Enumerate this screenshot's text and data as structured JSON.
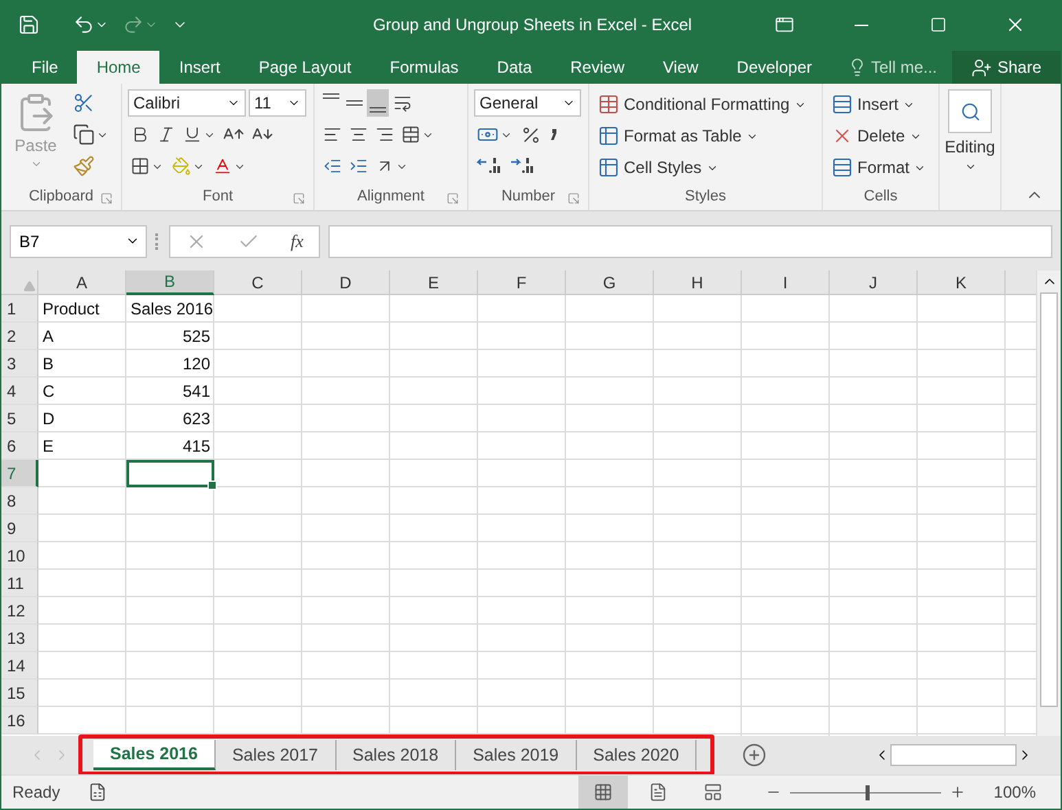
{
  "window": {
    "title": "Group and Ungroup Sheets in Excel - Excel"
  },
  "ribbon_tabs": [
    {
      "label": "File",
      "selected": false
    },
    {
      "label": "Home",
      "selected": true
    },
    {
      "label": "Insert",
      "selected": false
    },
    {
      "label": "Page Layout",
      "selected": false
    },
    {
      "label": "Formulas",
      "selected": false
    },
    {
      "label": "Data",
      "selected": false
    },
    {
      "label": "Review",
      "selected": false
    },
    {
      "label": "View",
      "selected": false
    },
    {
      "label": "Developer",
      "selected": false
    }
  ],
  "tell_me": {
    "placeholder": "Tell me..."
  },
  "share": "Share",
  "ribbon": {
    "paste": "Paste",
    "font_name": "Calibri",
    "font_size": "11",
    "vertical_align": [
      {
        "selected": false
      },
      {
        "selected": false
      },
      {
        "selected": true
      }
    ],
    "number_format": "General",
    "styles": [
      "Conditional Formatting",
      "Format as Table",
      "Cell Styles"
    ],
    "cells": [
      "Insert",
      "Delete",
      "Format"
    ],
    "editing": "Editing",
    "groups": [
      "Clipboard",
      "Font",
      "Alignment",
      "Number",
      "Styles",
      "Cells"
    ]
  },
  "formula_bar": {
    "name_box": "B7",
    "function_label": "fx"
  },
  "columns": [
    {
      "label": "A",
      "selected": false
    },
    {
      "label": "B",
      "selected": true
    },
    {
      "label": "C",
      "selected": false
    },
    {
      "label": "D",
      "selected": false
    },
    {
      "label": "E",
      "selected": false
    },
    {
      "label": "F",
      "selected": false
    },
    {
      "label": "G",
      "selected": false
    },
    {
      "label": "H",
      "selected": false
    },
    {
      "label": "I",
      "selected": false
    },
    {
      "label": "J",
      "selected": false
    },
    {
      "label": "K",
      "selected": false
    }
  ],
  "rows": [
    {
      "label": "1",
      "selected": false,
      "cells": [
        {
          "text": "Product",
          "kind": "text"
        },
        {
          "text": "Sales 2016",
          "kind": "text"
        }
      ]
    },
    {
      "label": "2",
      "selected": false,
      "cells": [
        {
          "text": "A",
          "kind": "text"
        },
        {
          "text": "525",
          "kind": "number"
        }
      ]
    },
    {
      "label": "3",
      "selected": false,
      "cells": [
        {
          "text": "B",
          "kind": "text"
        },
        {
          "text": "120",
          "kind": "number"
        }
      ]
    },
    {
      "label": "4",
      "selected": false,
      "cells": [
        {
          "text": "C",
          "kind": "text"
        },
        {
          "text": "541",
          "kind": "number"
        }
      ]
    },
    {
      "label": "5",
      "selected": false,
      "cells": [
        {
          "text": "D",
          "kind": "text"
        },
        {
          "text": "623",
          "kind": "number"
        }
      ]
    },
    {
      "label": "6",
      "selected": false,
      "cells": [
        {
          "text": "E",
          "kind": "text"
        },
        {
          "text": "415",
          "kind": "number"
        }
      ]
    },
    {
      "label": "7",
      "selected": true,
      "cells": []
    },
    {
      "label": "8",
      "selected": false,
      "cells": []
    },
    {
      "label": "9",
      "selected": false,
      "cells": []
    },
    {
      "label": "10",
      "selected": false,
      "cells": []
    },
    {
      "label": "11",
      "selected": false,
      "cells": []
    },
    {
      "label": "12",
      "selected": false,
      "cells": []
    },
    {
      "label": "13",
      "selected": false,
      "cells": []
    },
    {
      "label": "14",
      "selected": false,
      "cells": []
    },
    {
      "label": "15",
      "selected": false,
      "cells": []
    },
    {
      "label": "16",
      "selected": false,
      "cells": []
    }
  ],
  "sheet_tabs": {
    "highlighted": true,
    "tabs": [
      {
        "label": "Sales 2016",
        "selected": true
      },
      {
        "label": "Sales 2017",
        "selected": false
      },
      {
        "label": "Sales 2018",
        "selected": false
      },
      {
        "label": "Sales 2019",
        "selected": false
      },
      {
        "label": "Sales 2020",
        "selected": false
      }
    ]
  },
  "status_bar": {
    "status": "Ready",
    "views": [
      {
        "selected": true
      },
      {
        "selected": false
      },
      {
        "selected": false
      }
    ],
    "zoom": {
      "level": 0.5,
      "reading": "100%"
    }
  }
}
